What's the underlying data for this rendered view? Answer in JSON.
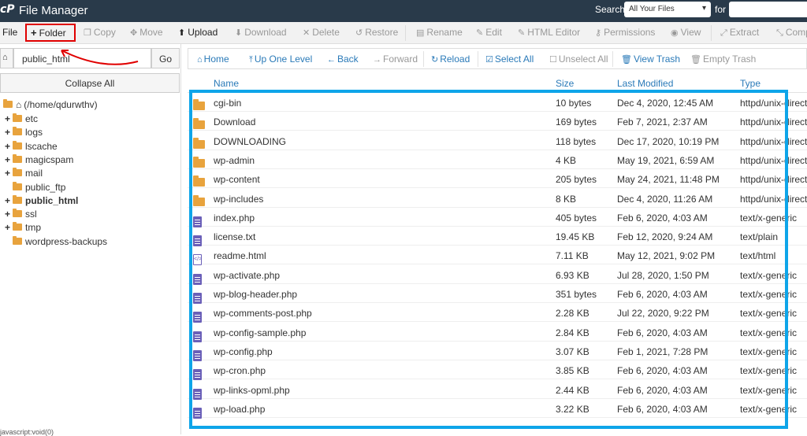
{
  "header": {
    "logo_text": "cP",
    "title": "File Manager",
    "search_label": "Search",
    "search_scope": "All Your Files",
    "for_label": "for"
  },
  "toolbar": {
    "file": "File",
    "folder": "Folder",
    "copy": "Copy",
    "move": "Move",
    "upload": "Upload",
    "download": "Download",
    "delete": "Delete",
    "restore": "Restore",
    "rename": "Rename",
    "edit": "Edit",
    "html_editor": "HTML Editor",
    "permissions": "Permissions",
    "view": "View",
    "extract": "Extract",
    "compress": "Comp"
  },
  "sidebar": {
    "path_value": "public_html",
    "go": "Go",
    "collapse_all": "Collapse All",
    "root_label": "(/home/qdurwthv)",
    "items": [
      {
        "label": "etc",
        "expandable": true
      },
      {
        "label": "logs",
        "expandable": true
      },
      {
        "label": "lscache",
        "expandable": true
      },
      {
        "label": "magicspam",
        "expandable": true
      },
      {
        "label": "mail",
        "expandable": true
      },
      {
        "label": "public_ftp",
        "expandable": false
      },
      {
        "label": "public_html",
        "expandable": true
      },
      {
        "label": "ssl",
        "expandable": true
      },
      {
        "label": "tmp",
        "expandable": true
      },
      {
        "label": "wordpress-backups",
        "expandable": false
      }
    ],
    "status": "javascript:void(0)"
  },
  "nav": {
    "home": "Home",
    "up_one_level": "Up One Level",
    "back": "Back",
    "forward": "Forward",
    "reload": "Reload",
    "select_all": "Select All",
    "unselect_all": "Unselect All",
    "view_trash": "View Trash",
    "empty_trash": "Empty Trash"
  },
  "table": {
    "columns": {
      "name": "Name",
      "size": "Size",
      "modified": "Last Modified",
      "type": "Type"
    },
    "rows": [
      {
        "name": "cgi-bin",
        "size": "10 bytes",
        "modified": "Dec 4, 2020, 12:45 AM",
        "type": "httpd/unix-directory",
        "icon": "folder"
      },
      {
        "name": "Download",
        "size": "169 bytes",
        "modified": "Feb 7, 2021, 2:37 AM",
        "type": "httpd/unix-directory",
        "icon": "folder"
      },
      {
        "name": "DOWNLOADING",
        "size": "118 bytes",
        "modified": "Dec 17, 2020, 10:19 PM",
        "type": "httpd/unix-directory",
        "icon": "folder"
      },
      {
        "name": "wp-admin",
        "size": "4 KB",
        "modified": "May 19, 2021, 6:59 AM",
        "type": "httpd/unix-directory",
        "icon": "folder"
      },
      {
        "name": "wp-content",
        "size": "205 bytes",
        "modified": "May 24, 2021, 11:48 PM",
        "type": "httpd/unix-directory",
        "icon": "folder"
      },
      {
        "name": "wp-includes",
        "size": "8 KB",
        "modified": "Dec 4, 2020, 11:26 AM",
        "type": "httpd/unix-directory",
        "icon": "folder"
      },
      {
        "name": "index.php",
        "size": "405 bytes",
        "modified": "Feb 6, 2020, 4:03 AM",
        "type": "text/x-generic",
        "icon": "file"
      },
      {
        "name": "license.txt",
        "size": "19.45 KB",
        "modified": "Feb 12, 2020, 9:24 AM",
        "type": "text/plain",
        "icon": "file"
      },
      {
        "name": "readme.html",
        "size": "7.11 KB",
        "modified": "May 12, 2021, 9:02 PM",
        "type": "text/html",
        "icon": "html"
      },
      {
        "name": "wp-activate.php",
        "size": "6.93 KB",
        "modified": "Jul 28, 2020, 1:50 PM",
        "type": "text/x-generic",
        "icon": "file"
      },
      {
        "name": "wp-blog-header.php",
        "size": "351 bytes",
        "modified": "Feb 6, 2020, 4:03 AM",
        "type": "text/x-generic",
        "icon": "file"
      },
      {
        "name": "wp-comments-post.php",
        "size": "2.28 KB",
        "modified": "Jul 22, 2020, 9:22 PM",
        "type": "text/x-generic",
        "icon": "file"
      },
      {
        "name": "wp-config-sample.php",
        "size": "2.84 KB",
        "modified": "Feb 6, 2020, 4:03 AM",
        "type": "text/x-generic",
        "icon": "file"
      },
      {
        "name": "wp-config.php",
        "size": "3.07 KB",
        "modified": "Feb 1, 2021, 7:28 PM",
        "type": "text/x-generic",
        "icon": "file"
      },
      {
        "name": "wp-cron.php",
        "size": "3.85 KB",
        "modified": "Feb 6, 2020, 4:03 AM",
        "type": "text/x-generic",
        "icon": "file"
      },
      {
        "name": "wp-links-opml.php",
        "size": "2.44 KB",
        "modified": "Feb 6, 2020, 4:03 AM",
        "type": "text/x-generic",
        "icon": "file"
      },
      {
        "name": "wp-load.php",
        "size": "3.22 KB",
        "modified": "Feb 6, 2020, 4:03 AM",
        "type": "text/x-generic",
        "icon": "file"
      }
    ]
  },
  "colors": {
    "header_bg": "#293a4a",
    "link": "#2a7ab8",
    "folder": "#e8a33d",
    "file": "#6a5fb8",
    "highlight_red": "#e00000",
    "highlight_blue": "#0ea5e9"
  }
}
